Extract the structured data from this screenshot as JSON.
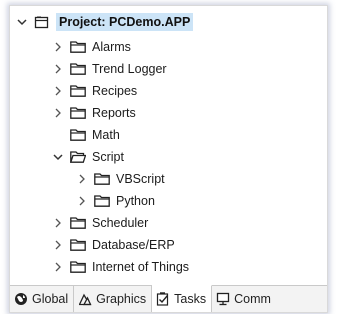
{
  "tree": {
    "root": {
      "label": "Project: PCDemo.APP",
      "icon": "project-icon"
    },
    "items": [
      {
        "label": "Alarms",
        "state": "collapsed"
      },
      {
        "label": "Trend Logger",
        "state": "collapsed"
      },
      {
        "label": "Recipes",
        "state": "collapsed"
      },
      {
        "label": "Reports",
        "state": "collapsed"
      },
      {
        "label": "Math",
        "state": "none"
      },
      {
        "label": "Script",
        "state": "expanded"
      },
      {
        "label": "VBScript",
        "state": "collapsed"
      },
      {
        "label": "Python",
        "state": "collapsed"
      },
      {
        "label": "Scheduler",
        "state": "collapsed"
      },
      {
        "label": "Database/ERP",
        "state": "collapsed"
      },
      {
        "label": "Internet of Things",
        "state": "collapsed"
      }
    ]
  },
  "tabs": [
    {
      "label": "Global",
      "icon": "globe-icon"
    },
    {
      "label": "Graphics",
      "icon": "graphics-icon"
    },
    {
      "label": "Tasks",
      "icon": "tasks-icon",
      "active": true
    },
    {
      "label": "Comm",
      "icon": "monitor-icon"
    }
  ],
  "colors": {
    "selection": "#cce4f7",
    "accent_border": "#c9c9c9"
  }
}
